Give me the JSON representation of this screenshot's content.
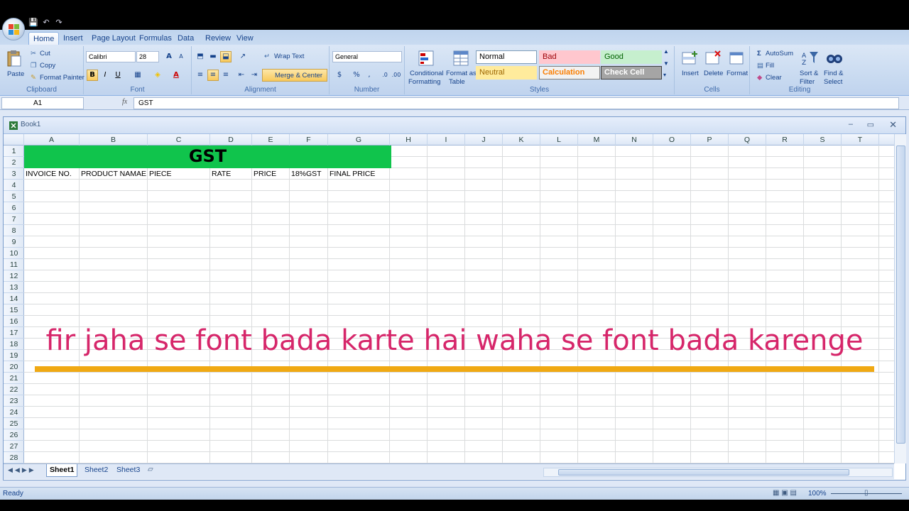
{
  "app": {
    "workbook_title": "Book1"
  },
  "qat": {
    "save": "💾",
    "undo": "↶",
    "redo": "↷"
  },
  "tabs": [
    "Home",
    "Insert",
    "Page Layout",
    "Formulas",
    "Data",
    "Review",
    "View"
  ],
  "ribbon": {
    "clipboard": {
      "paste": "Paste",
      "cut": "Cut",
      "copy": "Copy",
      "format_painter": "Format Painter",
      "label": "Clipboard"
    },
    "font": {
      "name": "Calibri",
      "size": "28",
      "bold": "B",
      "italic": "I",
      "underline": "U",
      "label": "Font",
      "grow": "A",
      "shrink": "A",
      "color": "A"
    },
    "alignment": {
      "wrap": "Wrap Text",
      "merge": "Merge & Center",
      "label": "Alignment"
    },
    "number": {
      "format": "General",
      "label": "Number",
      "currency": "$",
      "percent": "%",
      "comma": ","
    },
    "styles": {
      "conditional": [
        "Conditional",
        "Formatting"
      ],
      "format_table": [
        "Format as",
        "Table"
      ],
      "cells": [
        {
          "label": "Normal",
          "bg": "#ffffff",
          "fg": "#000000",
          "border": "#7f9db9"
        },
        {
          "label": "Bad",
          "bg": "#ffc7ce",
          "fg": "#9c0006",
          "border": "#ffc7ce"
        },
        {
          "label": "Good",
          "bg": "#c6efce",
          "fg": "#006100",
          "border": "#c6efce"
        },
        {
          "label": "Neutral",
          "bg": "#ffeb9c",
          "fg": "#9c6500",
          "border": "#ffeb9c"
        },
        {
          "label": "Calculation",
          "bg": "#f2f2f2",
          "fg": "#fa7d00",
          "border": "#7f7f7f"
        },
        {
          "label": "Check Cell",
          "bg": "#a5a5a5",
          "fg": "#ffffff",
          "border": "#3f3f3f"
        }
      ],
      "label": "Styles"
    },
    "cells_group": {
      "insert": "Insert",
      "delete": "Delete",
      "format": "Format",
      "label": "Cells"
    },
    "editing": {
      "autosum": "AutoSum",
      "fill": "Fill",
      "clear": "Clear",
      "sort": [
        "Sort &",
        "Filter"
      ],
      "find": [
        "Find &",
        "Select"
      ],
      "label": "Editing",
      "sigma": "Σ"
    }
  },
  "formula_bar": {
    "name_box": "A1",
    "fx": "fx",
    "content": "GST"
  },
  "sheet": {
    "columns": [
      "A",
      "B",
      "C",
      "D",
      "E",
      "F",
      "G",
      "H",
      "I",
      "J",
      "K",
      "L",
      "M",
      "N",
      "O",
      "P",
      "Q",
      "R",
      "S",
      "T"
    ],
    "rows": [
      "1",
      "2",
      "3",
      "4",
      "5",
      "6",
      "7",
      "8",
      "9",
      "10",
      "11",
      "12",
      "13",
      "14",
      "15",
      "16",
      "17",
      "18",
      "19",
      "20",
      "21",
      "22",
      "23",
      "24",
      "25",
      "26",
      "27",
      "28"
    ],
    "title_cell": "GST",
    "headers": [
      "INVOICE NO.",
      "PRODUCT NAMAE",
      "PIECE",
      "RATE",
      "PRICE",
      "18%GST",
      "FINAL PRICE"
    ],
    "title_fill": "#10c44c"
  },
  "sheet_tabs": [
    "Sheet1",
    "Sheet2",
    "Sheet3"
  ],
  "status": {
    "ready": "Ready",
    "zoom": "100%"
  },
  "overlay": {
    "caption": "fir jaha se font bada karte hai waha se font bada karenge",
    "caption_color": "#d6266a",
    "underline_color": "#f0a913"
  }
}
